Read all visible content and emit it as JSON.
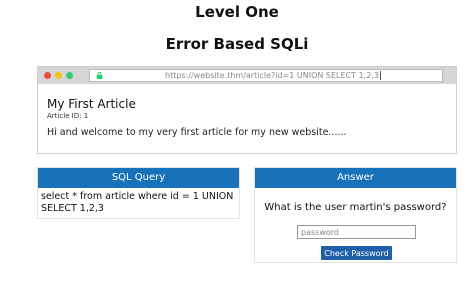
{
  "header": {
    "level": "Level One",
    "title": "Error Based SQLi"
  },
  "browser": {
    "url": "https://website.thm/article?id=1 UNION SELECT 1,2,3",
    "article": {
      "title": "My First Article",
      "id_label": "Article ID: 1",
      "body": "Hi and welcome to my very first article for my new website......"
    }
  },
  "sql_panel": {
    "heading": "SQL Query",
    "query": "select * from article where id = 1 UNION SELECT 1,2,3"
  },
  "answer_panel": {
    "heading": "Answer",
    "question": "What is the user martin's password?",
    "input_placeholder": "password",
    "button_label": "Check Password"
  },
  "colors": {
    "panel_header": "#1872b9",
    "button": "#1e5fa8",
    "browser_bar": "#d6d6d6"
  }
}
